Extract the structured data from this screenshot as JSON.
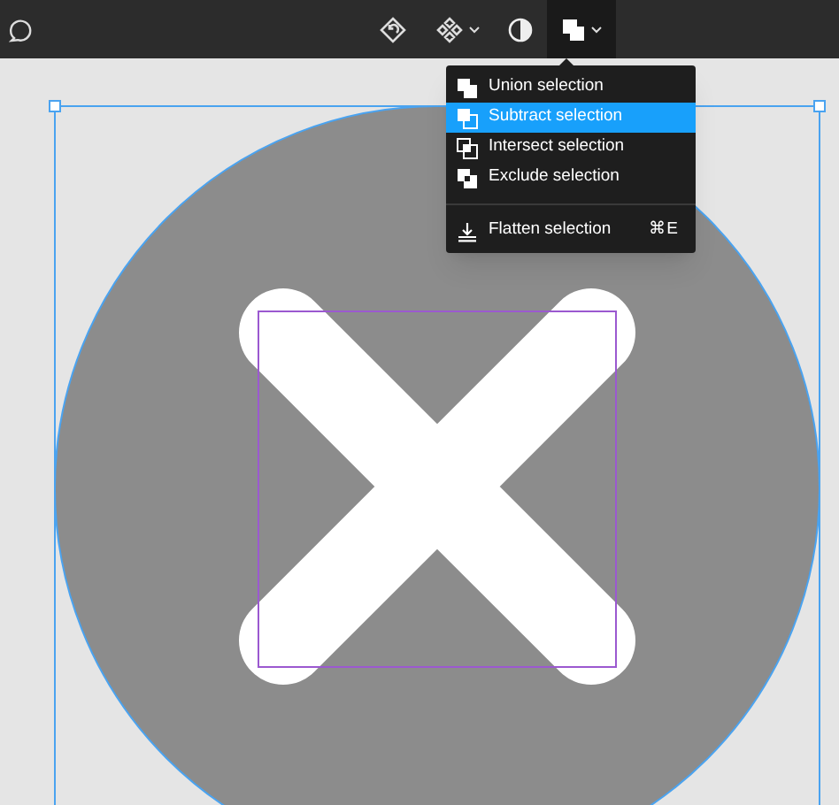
{
  "toolbar": {
    "tools": [
      {
        "kind": "rotate",
        "selected": false,
        "dropdown": false
      },
      {
        "kind": "component",
        "selected": false,
        "dropdown": true
      },
      {
        "kind": "contrast",
        "selected": false,
        "dropdown": false
      },
      {
        "kind": "boolean",
        "selected": true,
        "dropdown": true
      }
    ]
  },
  "menu": {
    "groups": [
      [
        {
          "kind": "union",
          "label": "Union selection",
          "selected": false
        },
        {
          "kind": "subtract",
          "label": "Subtract selection",
          "selected": true
        },
        {
          "kind": "intersect",
          "label": "Intersect selection",
          "selected": false
        },
        {
          "kind": "exclude",
          "label": "Exclude selection",
          "selected": false
        }
      ],
      [
        {
          "kind": "flatten",
          "label": "Flatten selection",
          "shortcut": "⌘E",
          "selected": false
        }
      ]
    ]
  }
}
